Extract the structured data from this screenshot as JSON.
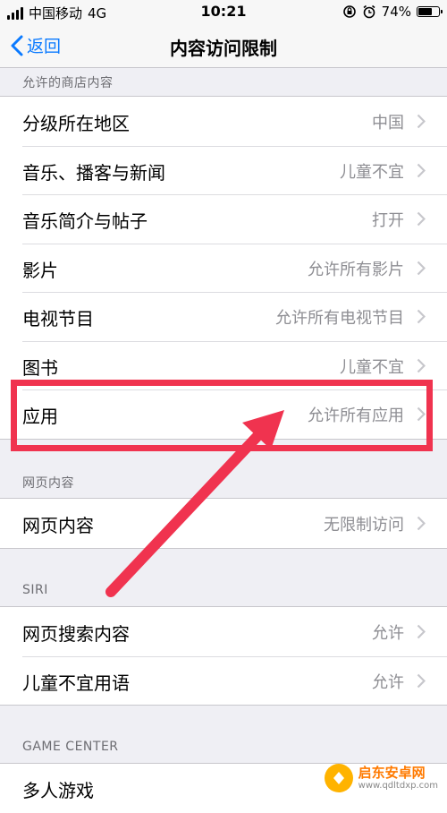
{
  "status_bar": {
    "carrier": "中国移动",
    "network": "4G",
    "time": "10:21",
    "battery": "74%",
    "battery_level": 0.74
  },
  "nav": {
    "back_label": "返回",
    "title": "内容访问限制"
  },
  "sections": {
    "store": {
      "header": "允许的商店内容",
      "rows": [
        {
          "label": "分级所在地区",
          "value": "中国"
        },
        {
          "label": "音乐、播客与新闻",
          "value": "儿童不宜"
        },
        {
          "label": "音乐简介与帖子",
          "value": "打开"
        },
        {
          "label": "影片",
          "value": "允许所有影片"
        },
        {
          "label": "电视节目",
          "value": "允许所有电视节目"
        },
        {
          "label": "图书",
          "value": "儿童不宜"
        },
        {
          "label": "应用",
          "value": "允许所有应用"
        }
      ]
    },
    "web": {
      "header": "网页内容",
      "rows": [
        {
          "label": "网页内容",
          "value": "无限制访问"
        }
      ]
    },
    "siri": {
      "header": "SIRI",
      "rows": [
        {
          "label": "网页搜索内容",
          "value": "允许"
        },
        {
          "label": "儿童不宜用语",
          "value": "允许"
        }
      ]
    },
    "game_center": {
      "header": "GAME CENTER",
      "rows": [
        {
          "label": "多人游戏",
          "value": ""
        }
      ]
    }
  },
  "watermark": {
    "title": "启东安卓网",
    "url": "www.qdltdxp.com"
  },
  "colors": {
    "accent": "#0a7aff",
    "annotation": "#f0334f",
    "background": "#efeff4"
  }
}
